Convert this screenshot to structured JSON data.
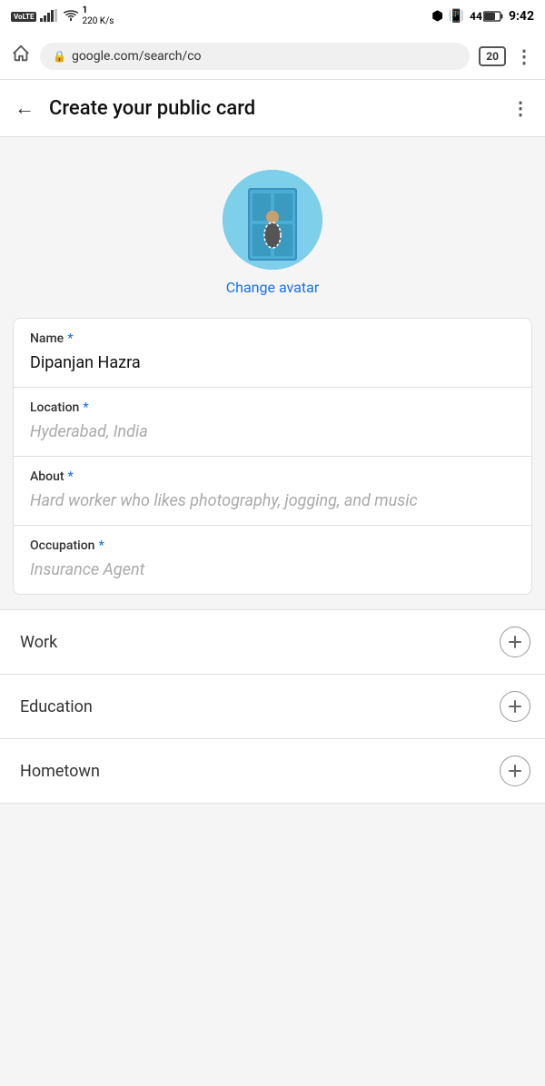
{
  "statusBar": {
    "left": {
      "volte": "VoLTE",
      "signal": "4G",
      "data_speed": "220 K/s"
    },
    "right": {
      "bluetooth": "⚡",
      "battery_pct": "44",
      "time": "9:42"
    }
  },
  "browserBar": {
    "url": "google.com/search/co",
    "tab_count": "20",
    "lock_icon": "🔒"
  },
  "pageHeader": {
    "title": "Create your public card",
    "back_label": "←",
    "more_label": "⋮"
  },
  "avatar": {
    "change_label": "Change avatar"
  },
  "formCard": {
    "fields": [
      {
        "label": "Name",
        "required": true,
        "value": "Dipanjan Hazra",
        "placeholder": ""
      },
      {
        "label": "Location",
        "required": true,
        "value": "",
        "placeholder": "Hyderabad, India"
      },
      {
        "label": "About",
        "required": true,
        "value": "",
        "placeholder": "Hard worker who likes photography, jogging, and music"
      },
      {
        "label": "Occupation",
        "required": true,
        "value": "",
        "placeholder": "Insurance Agent"
      }
    ]
  },
  "expandableSections": [
    {
      "label": "Work",
      "plus": "+"
    },
    {
      "label": "Education",
      "plus": "+"
    },
    {
      "label": "Hometown",
      "plus": "+"
    }
  ]
}
